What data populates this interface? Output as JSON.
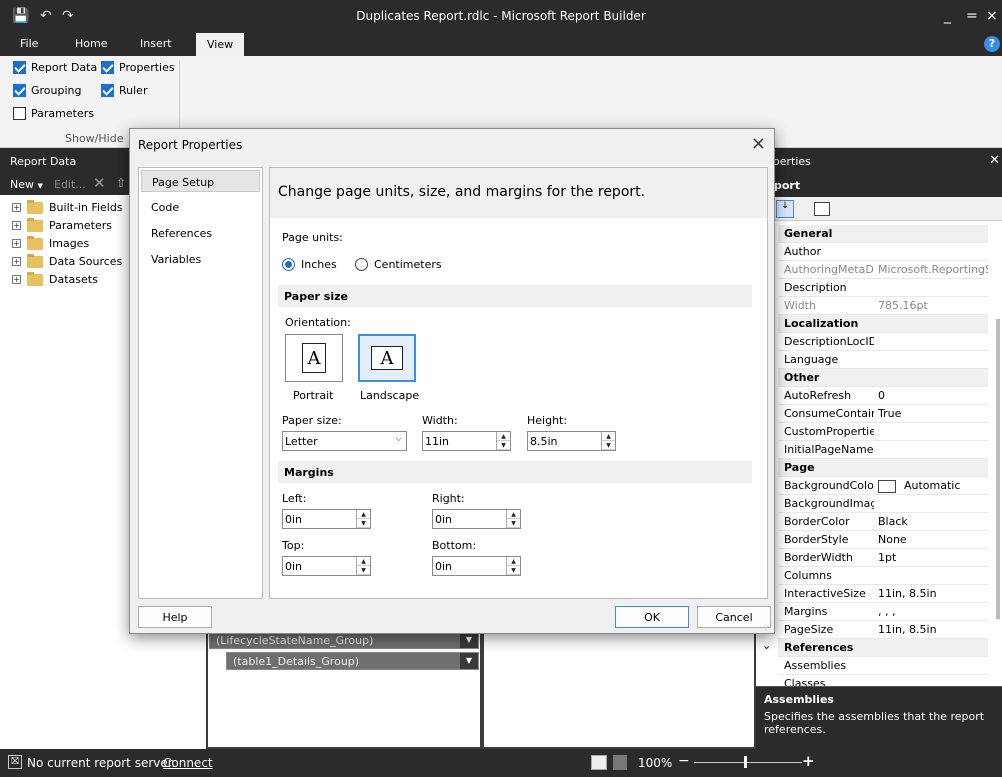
{
  "window": {
    "title": "Duplicates Report.rdlc - Microsoft Report Builder",
    "minimize": "_",
    "restore": "=",
    "close": "×"
  },
  "quick_access": {
    "save": "💾",
    "undo": "↶",
    "redo": "↷"
  },
  "ribbon": {
    "tabs": [
      "File",
      "Home",
      "Insert",
      "View"
    ],
    "active_tab": "View",
    "help": "?",
    "show_hide": {
      "report_data": {
        "label": "Report Data",
        "checked": true
      },
      "properties": {
        "label": "Properties",
        "checked": true
      },
      "grouping": {
        "label": "Grouping",
        "checked": true
      },
      "ruler": {
        "label": "Ruler",
        "checked": true
      },
      "parameters": {
        "label": "Parameters",
        "checked": false
      },
      "group_label": "Show/Hide"
    }
  },
  "report_data_pane": {
    "title": "Report Data",
    "new_label": "New",
    "edit_label": "Edit...",
    "items": [
      "Built-in Fields",
      "Parameters",
      "Images",
      "Data Sources",
      "Datasets"
    ]
  },
  "grouping": {
    "row_group_1": "(LifecycleStateName_Group)",
    "row_group_2": "(table1_Details_Group)"
  },
  "properties_pane": {
    "title": "operties",
    "object": "port",
    "categories": [
      {
        "name": "General",
        "rows": [
          {
            "name": "Author",
            "value": ""
          },
          {
            "name": "AuthoringMetaDa",
            "value": "Microsoft.ReportingSe",
            "dim": true
          },
          {
            "name": "Description",
            "value": ""
          },
          {
            "name": "Width",
            "value": "785.16pt",
            "dim": true
          }
        ]
      },
      {
        "name": "Localization",
        "rows": [
          {
            "name": "DescriptionLocID",
            "value": ""
          },
          {
            "name": "Language",
            "value": ""
          }
        ]
      },
      {
        "name": "Other",
        "rows": [
          {
            "name": "AutoRefresh",
            "value": "0"
          },
          {
            "name": "ConsumeContain",
            "value": "True"
          },
          {
            "name": "CustomProperties",
            "value": ""
          },
          {
            "name": "InitialPageName",
            "value": ""
          }
        ]
      },
      {
        "name": "Page",
        "rows": [
          {
            "name": "BackgroundColor",
            "value": "Automatic",
            "swatch": true
          },
          {
            "name": "BackgroundImag",
            "value": ""
          },
          {
            "name": "BorderColor",
            "value": "Black"
          },
          {
            "name": "BorderStyle",
            "value": "None"
          },
          {
            "name": "BorderWidth",
            "value": "1pt"
          },
          {
            "name": "Columns",
            "value": ""
          },
          {
            "name": "InteractiveSize",
            "value": "11in, 8.5in"
          },
          {
            "name": "Margins",
            "value": ", , ,"
          },
          {
            "name": "PageSize",
            "value": "11in, 8.5in"
          }
        ]
      },
      {
        "name": "References",
        "rows": [
          {
            "name": "Assemblies",
            "value": ""
          },
          {
            "name": "Classes",
            "value": ""
          }
        ]
      }
    ],
    "desc_title": "Assemblies",
    "desc_text": "Specifies the assemblies that the report references."
  },
  "status_bar": {
    "server_text": "No current report server.",
    "connect_label": "Connect",
    "zoom": "100%"
  },
  "dialog": {
    "title": "Report Properties",
    "close": "×",
    "nav": [
      "Page Setup",
      "Code",
      "References",
      "Variables"
    ],
    "selected_nav": "Page Setup",
    "header": "Change page units, size, and margins for the report.",
    "page_units_label": "Page units:",
    "unit_inches": "Inches",
    "unit_cm": "Centimeters",
    "paper_size_section": "Paper size",
    "orientation_label": "Orientation:",
    "portrait": "Portrait",
    "landscape": "Landscape",
    "orientation_glyph": "A",
    "paper_size_label": "Paper size:",
    "paper_size_value": "Letter",
    "width_label": "Width:",
    "width_value": "11in",
    "height_label": "Height:",
    "height_value": "8.5in",
    "margins_section": "Margins",
    "left_label": "Left:",
    "left_value": "0in",
    "right_label": "Right:",
    "right_value": "0in",
    "top_label": "Top:",
    "top_value": "0in",
    "bottom_label": "Bottom:",
    "bottom_value": "0in",
    "help_btn": "Help",
    "ok_btn": "OK",
    "cancel_btn": "Cancel"
  }
}
